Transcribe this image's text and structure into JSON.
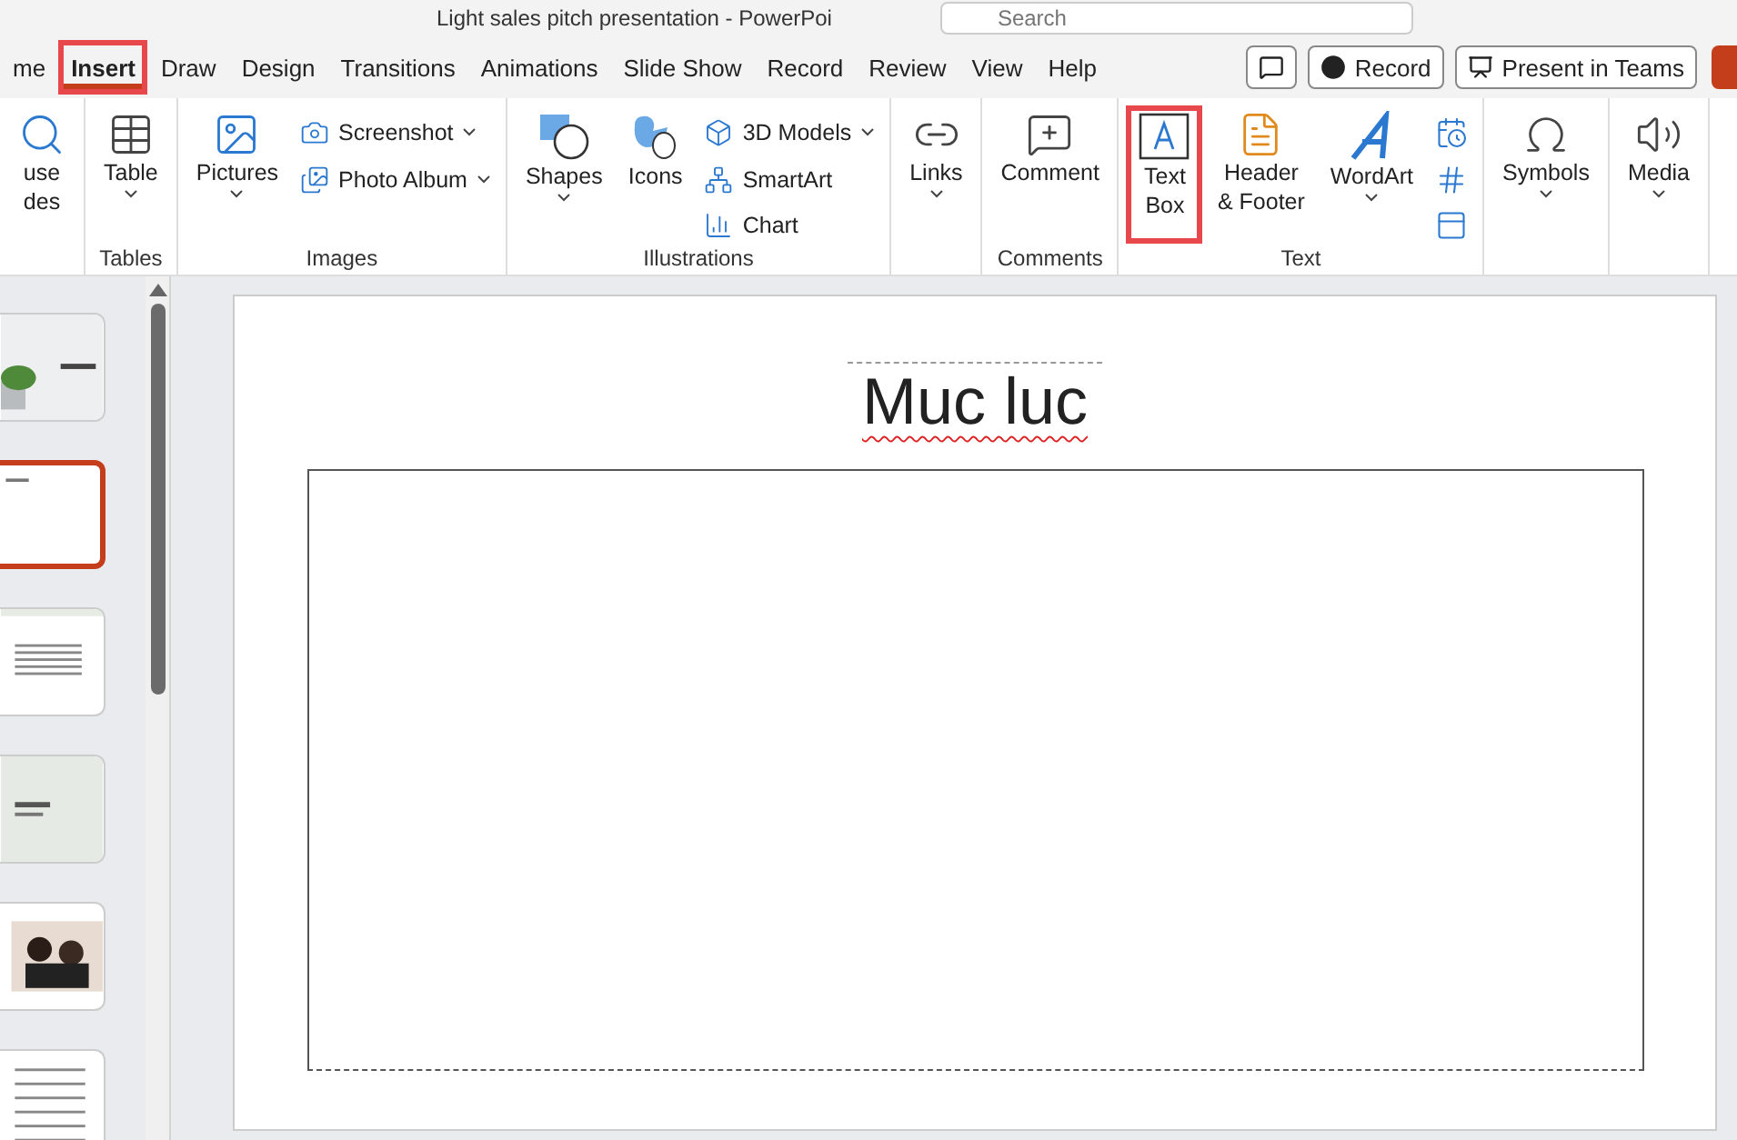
{
  "window": {
    "title": "Light sales pitch presentation  -  PowerPoi",
    "search": {
      "placeholder": "Search"
    }
  },
  "tabs": [
    {
      "label": "me",
      "selected": false,
      "highlighted": false
    },
    {
      "label": "Insert",
      "selected": true,
      "highlighted": true
    },
    {
      "label": "Draw",
      "selected": false,
      "highlighted": false
    },
    {
      "label": "Design",
      "selected": false,
      "highlighted": false
    },
    {
      "label": "Transitions",
      "selected": false,
      "highlighted": false
    },
    {
      "label": "Animations",
      "selected": false,
      "highlighted": false
    },
    {
      "label": "Slide Show",
      "selected": false,
      "highlighted": false
    },
    {
      "label": "Record",
      "selected": false,
      "highlighted": false
    },
    {
      "label": "Review",
      "selected": false,
      "highlighted": false
    },
    {
      "label": "View",
      "selected": false,
      "highlighted": false
    },
    {
      "label": "Help",
      "selected": false,
      "highlighted": false
    }
  ],
  "header_buttons": [
    {
      "kind": "comment"
    },
    {
      "kind": "record",
      "label": "Record"
    },
    {
      "kind": "teams",
      "label": "Present in Teams"
    },
    {
      "kind": "share"
    }
  ],
  "ribbon": [
    {
      "items": [
        {
          "kind": "large",
          "lines": [
            "use",
            "des"
          ],
          "caret": false,
          "highlighted": false
        }
      ]
    },
    {
      "label": "Tables",
      "items": [
        {
          "kind": "large",
          "lines": [
            "Table"
          ],
          "caret": true,
          "highlighted": false
        }
      ]
    },
    {
      "label": "Images",
      "items": [
        {
          "kind": "large",
          "lines": [
            "Pictures"
          ],
          "caret": true,
          "highlighted": false
        },
        {
          "kind": "stack",
          "items": [
            {
              "label": "Screenshot",
              "caret": true
            },
            {
              "label": "Photo Album",
              "caret": true
            }
          ]
        }
      ]
    },
    {
      "label": "Illustrations",
      "items": [
        {
          "kind": "large",
          "lines": [
            "Shapes"
          ],
          "caret": true,
          "highlighted": false
        },
        {
          "kind": "large",
          "lines": [
            "Icons"
          ],
          "caret": false,
          "highlighted": false
        },
        {
          "kind": "stack",
          "items": [
            {
              "label": "3D Models",
              "caret": true
            },
            {
              "label": "SmartArt",
              "caret": false
            },
            {
              "label": "Chart",
              "caret": false
            }
          ]
        }
      ]
    },
    {
      "items": [
        {
          "kind": "large",
          "lines": [
            "Links"
          ],
          "caret": true,
          "highlighted": false
        }
      ]
    },
    {
      "label": "Comments",
      "items": [
        {
          "kind": "large",
          "lines": [
            "Comment"
          ],
          "caret": false,
          "highlighted": false
        }
      ]
    },
    {
      "label": "Text",
      "items": [
        {
          "kind": "large",
          "lines": [
            "Text",
            "Box"
          ],
          "caret": false,
          "highlighted": true
        },
        {
          "kind": "large",
          "lines": [
            "Header",
            "& Footer"
          ],
          "caret": false,
          "highlighted": false
        },
        {
          "kind": "large",
          "lines": [
            "WordArt"
          ],
          "caret": true,
          "highlighted": false
        },
        {
          "kind": "icons"
        }
      ]
    },
    {
      "items": [
        {
          "kind": "large",
          "lines": [
            "Symbols"
          ],
          "caret": true,
          "highlighted": false
        }
      ]
    },
    {
      "items": [
        {
          "kind": "large",
          "lines": [
            "Media"
          ],
          "caret": true,
          "highlighted": false
        }
      ]
    }
  ],
  "slides": [
    {
      "selected": false
    },
    {
      "selected": true
    },
    {
      "selected": false
    },
    {
      "selected": false
    },
    {
      "selected": false
    },
    {
      "selected": false
    }
  ],
  "slide": {
    "title": "Muc luc"
  }
}
